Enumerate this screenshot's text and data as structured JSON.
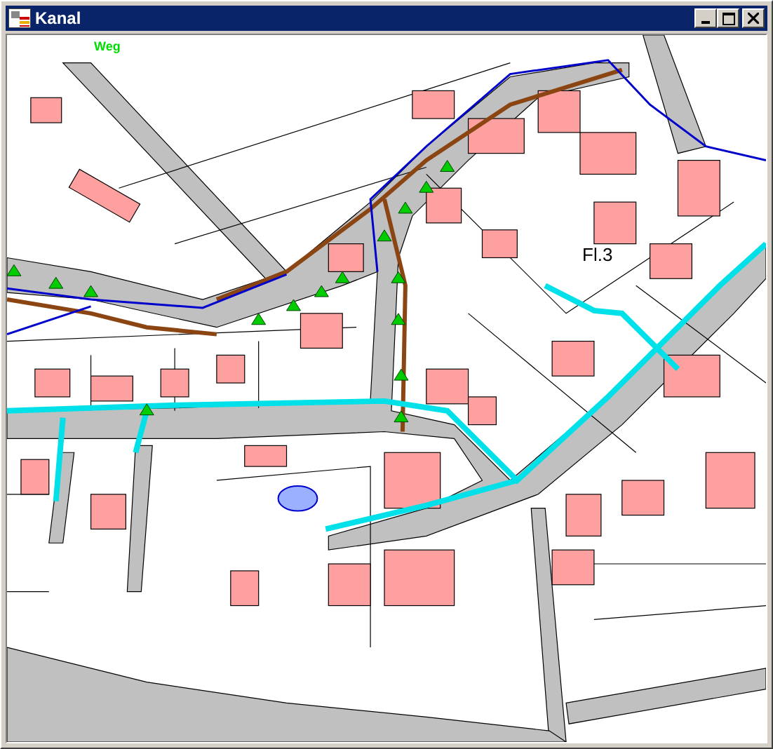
{
  "window": {
    "title": "Kanal"
  },
  "map": {
    "labels": [
      {
        "kind": "street",
        "text": "Weg"
      },
      {
        "kind": "parcel",
        "text": "Fl.3"
      }
    ]
  }
}
